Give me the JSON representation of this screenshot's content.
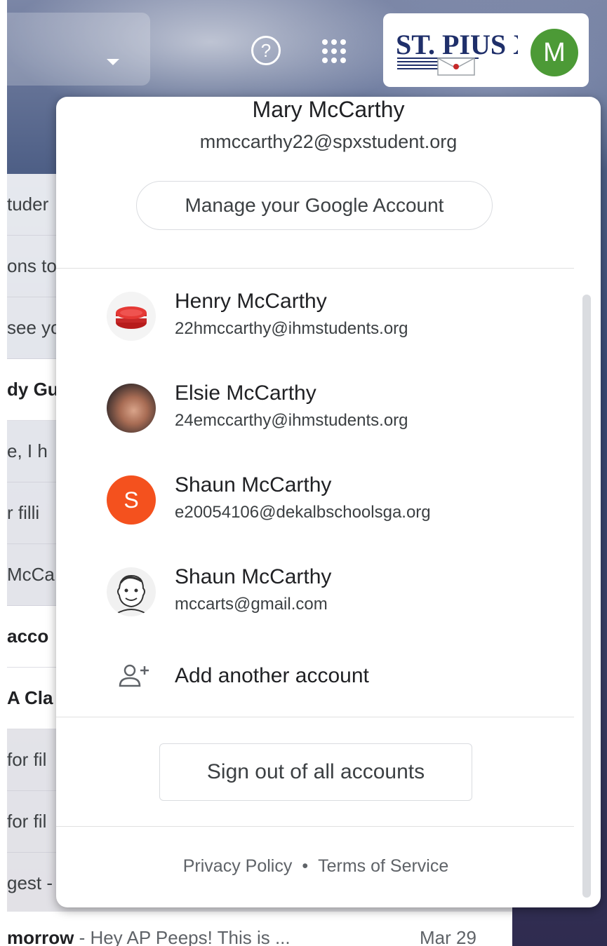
{
  "header": {
    "org_logo_text": "ST. PIUS X",
    "account_initial": "M",
    "help_glyph": "?"
  },
  "background_mail": {
    "row_fragments": [
      "tuder",
      "ons to",
      "see yo",
      "dy Gu",
      "e, I h",
      "r filli",
      "McCa",
      "acco",
      "A Cla",
      "for fil",
      "for fil",
      "gest -"
    ],
    "bottom_row": {
      "subject": "morrow",
      "snippet": " - Hey AP Peeps! This is ...",
      "date": "Mar 29"
    }
  },
  "popup": {
    "current_account": {
      "name": "Mary McCarthy",
      "email": "mmccarthy22@spxstudent.org"
    },
    "manage_button_label": "Manage your Google Account",
    "accounts": [
      {
        "name": "Henry McCarthy",
        "email": "22hmccarthy@ihmstudents.org",
        "avatar": "red-velvet-cake-photo"
      },
      {
        "name": "Elsie McCarthy",
        "email": "24emccarthy@ihmstudents.org",
        "avatar": "profile-photo"
      },
      {
        "name": "Shaun McCarthy",
        "email": "e20054106@dekalbschoolsga.org",
        "avatar_letter": "S"
      },
      {
        "name": "Shaun McCarthy",
        "email": "mccarts@gmail.com",
        "avatar": "cartoon-portrait"
      }
    ],
    "add_account_label": "Add another account",
    "sign_out_label": "Sign out of all accounts",
    "footer": {
      "privacy": "Privacy Policy",
      "separator": "•",
      "terms": "Terms of Service"
    }
  },
  "colors": {
    "avatar_m": "#4c9a36",
    "avatar_s": "#f4511e",
    "logo_navy": "#1f2f6a"
  },
  "icons": {
    "help": "help-circle-icon",
    "apps": "apps-grid-icon",
    "dropdown": "caret-down-icon",
    "add_account": "person-add-icon"
  }
}
